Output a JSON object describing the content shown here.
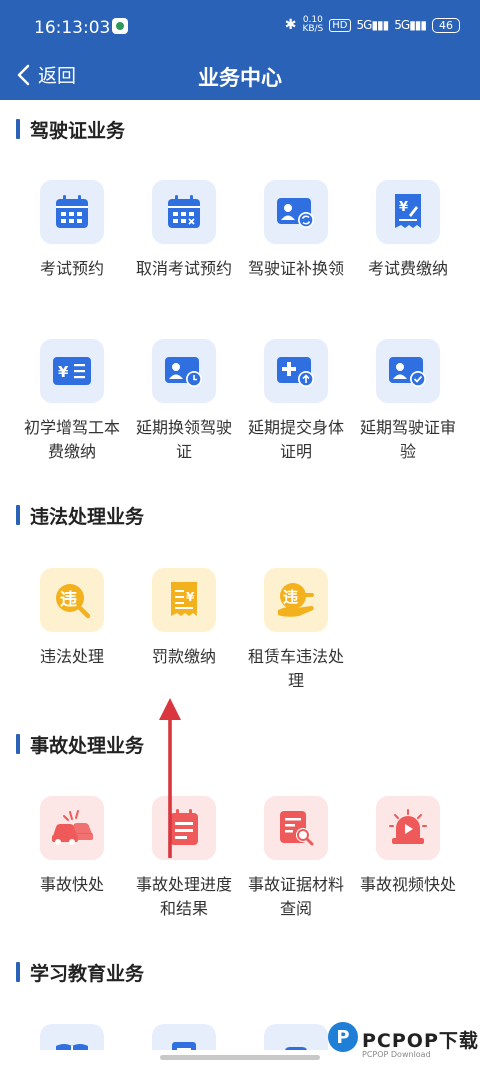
{
  "status": {
    "time": "16:13:03",
    "speed_top": "0.10",
    "speed_bottom": "KB/S",
    "hd": "HD",
    "sig1": "5G",
    "sig2": "5G",
    "battery": "46"
  },
  "nav": {
    "back_label": "返回",
    "title": "业务中心"
  },
  "sections": {
    "license": "驾驶证业务",
    "violation": "违法处理业务",
    "accident": "事故处理业务",
    "education": "学习教育业务"
  },
  "license_items": [
    "考试预约",
    "取消考试预约",
    "驾驶证补换领",
    "考试费缴纳",
    "初学增驾工本费缴纳",
    "延期换领驾驶证",
    "延期提交身体证明",
    "延期驾驶证审验"
  ],
  "violation_items": [
    "违法处理",
    "罚款缴纳",
    "租赁车违法处理"
  ],
  "accident_items": [
    "事故快处",
    "事故处理进度和结果",
    "事故证据材料查阅",
    "事故视频快处"
  ],
  "icon_text": {
    "yen": "¥",
    "violation_char": "违"
  },
  "icons": {
    "license": [
      "calendar-icon",
      "calendar-cancel-icon",
      "id-card-swap-icon",
      "fee-receipt-icon",
      "yen-list-icon",
      "id-card-clock-icon",
      "card-plus-upload-icon",
      "id-card-check-icon"
    ],
    "violation": [
      "violation-search-icon",
      "fine-receipt-icon",
      "rental-violation-icon"
    ],
    "accident": [
      "car-crash-icon",
      "clipboard-progress-icon",
      "document-search-icon",
      "alarm-video-icon"
    ]
  },
  "colors": {
    "brand": "#2a62b8",
    "icon_blue": "#2f6fe0",
    "icon_yellow": "#f4b11e",
    "icon_red": "#ee5a5a",
    "annotation_arrow": "#d9363e"
  },
  "watermark": {
    "text": "PCPOP下载",
    "sub": "PCPOP Download"
  }
}
